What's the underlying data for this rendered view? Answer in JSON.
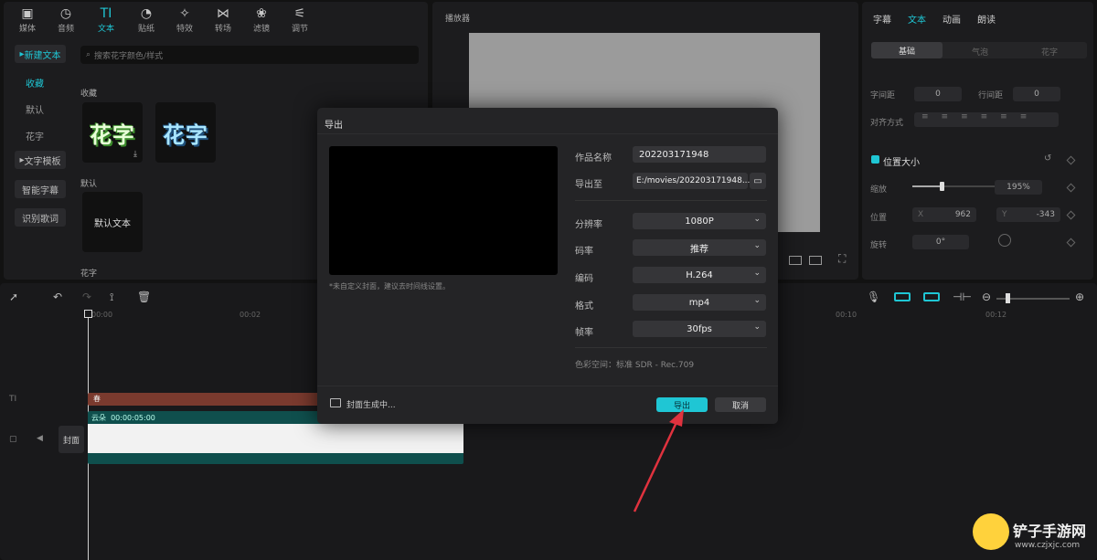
{
  "toolbar": {
    "tools": [
      {
        "label": "媒体",
        "icon": "media-icon"
      },
      {
        "label": "音频",
        "icon": "audio-icon"
      },
      {
        "label": "文本",
        "icon": "text-icon"
      },
      {
        "label": "贴纸",
        "icon": "sticker-icon"
      },
      {
        "label": "特效",
        "icon": "effects-icon"
      },
      {
        "label": "转场",
        "icon": "transition-icon"
      },
      {
        "label": "滤镜",
        "icon": "filter-icon"
      },
      {
        "label": "调节",
        "icon": "adjust-icon"
      }
    ]
  },
  "left_sidebar": {
    "new_text": "新建文本",
    "favorites": "收藏",
    "default": "默认",
    "flower_text": "花字",
    "text_template": "文字模板",
    "smart_subtitle": "智能字幕",
    "recognize_lyrics": "识别歌词"
  },
  "text_library": {
    "search_placeholder": "搜索花字颜色/样式",
    "section_favorites": "收藏",
    "flower_sample": "花字",
    "section_default": "默认",
    "default_text_card": "默认文本",
    "section_flower": "花字"
  },
  "player": {
    "title": "播放器"
  },
  "right_panel": {
    "tabs": [
      "字幕",
      "文本",
      "动画",
      "朗读"
    ],
    "subtabs": [
      "基础",
      "气泡",
      "花字"
    ],
    "char_spacing_label": "字间距",
    "char_spacing_value": "0",
    "line_spacing_label": "行间距",
    "line_spacing_value": "0",
    "align_label": "对齐方式",
    "position_size_label": "位置大小",
    "scale_label": "缩放",
    "scale_value": "195%",
    "position_label": "位置",
    "x_label": "X",
    "x_value": "962",
    "y_label": "Y",
    "y_value": "-343",
    "rotate_label": "旋转",
    "rotate_value": "0°"
  },
  "timeline": {
    "ruler": [
      "00:00",
      "00:02",
      "00:10",
      "00:12"
    ],
    "text_clip": "春",
    "video_clip_label": "云朵",
    "video_clip_duration": "00:00:05:00",
    "cover_label": "封面",
    "track_text_label": "TI",
    "zoom_level": 0.3
  },
  "export_dialog": {
    "title": "导出",
    "cover_hint": "*未自定义封面，建议去时间线设置。",
    "name_label": "作品名称",
    "name_value": "202203171948",
    "export_to_label": "导出至",
    "export_to_value": "E:/movies/202203171948...",
    "resolution_label": "分辨率",
    "resolution_value": "1080P",
    "bitrate_label": "码率",
    "bitrate_value": "推荐",
    "codec_label": "编码",
    "codec_value": "H.264",
    "format_label": "格式",
    "format_value": "mp4",
    "framerate_label": "帧率",
    "framerate_value": "30fps",
    "color_space": "色彩空间：标准 SDR - Rec.709",
    "status": "封面生成中...",
    "export_button": "导出",
    "cancel_button": "取消"
  },
  "watermark": {
    "title": "铲子手游网",
    "url": "www.czjxjc.com"
  },
  "colors": {
    "accent": "#1fc6d4",
    "text_clip": "#7a3a2e",
    "video_clip": "#0f4f4d",
    "arrow": "#e0323e"
  }
}
